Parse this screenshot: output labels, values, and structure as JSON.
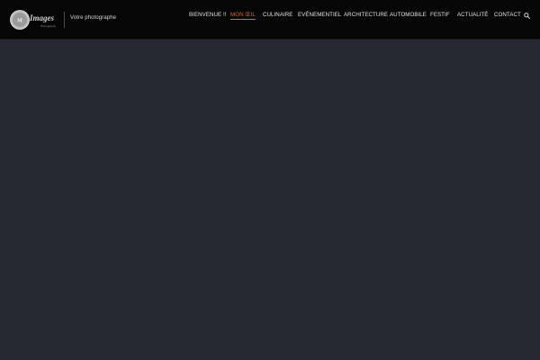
{
  "header": {
    "logo_text": "Images",
    "logo_subtext": "Photography",
    "tagline": "Votre photographe"
  },
  "nav": {
    "items": [
      {
        "label": "BIENVENUE !!"
      },
      {
        "label": "MON ŒIL"
      },
      {
        "label": "CULINAIRE"
      },
      {
        "label": "EVÉNEMENTIEL"
      },
      {
        "label": "ARCHITECTURE"
      },
      {
        "label": "AUTOMOBILE"
      },
      {
        "label": "FESTIF"
      },
      {
        "label": "ACTUALITÉ"
      },
      {
        "label": "CONTACT"
      }
    ],
    "active_index": 1
  },
  "icons": {
    "search": "search-icon"
  },
  "colors": {
    "header_bg": "#060607",
    "page_bg": "#262932",
    "accent": "#d9643a",
    "nav_text": "#e4e4e4"
  }
}
